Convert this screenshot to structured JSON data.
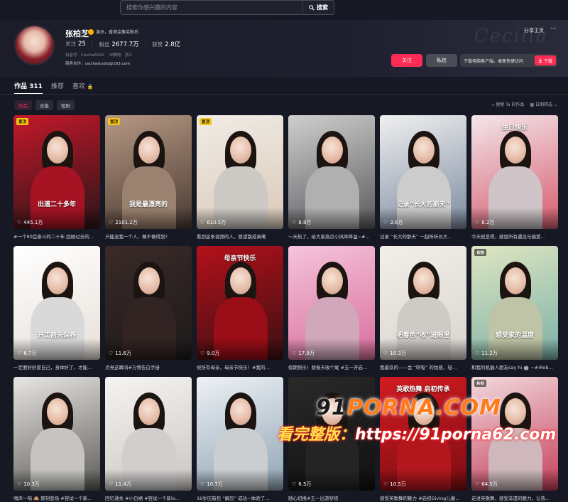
{
  "search": {
    "placeholder": "搜索你感兴趣的内容",
    "button": "搜索"
  },
  "profile": {
    "name": "张柏芝",
    "verify_text": "演员，香港金像奖影后",
    "following_label": "关注",
    "following": "25",
    "followers_label": "粉丝",
    "followers": "2677.7万",
    "likes_label": "获赞",
    "likes": "2.8亿",
    "douyin_id": "抖音号：Cecilia0524",
    "ip": "IP属地：浙江",
    "business": "商务合作：ceciliastudio@163.com",
    "signature_bg": "Cecilia",
    "share": "分享主页",
    "more": "···",
    "follow_button": "关注",
    "message_button": "私信",
    "download_text": "下载电脑客户端，桌面快捷访问",
    "download_button": "下载"
  },
  "tabs": [
    {
      "label": "作品 311"
    },
    {
      "label": "推荐"
    },
    {
      "label": "喜欢"
    }
  ],
  "chips": [
    "作品",
    "合集",
    "短剧"
  ],
  "tools": {
    "search": "搜索 Ta 的作品",
    "filter": "日期筛选"
  },
  "videos": [
    {
      "pin": "置顶",
      "likes": "445.1万",
      "caption": "出道二十多年",
      "title": "#一个90后奋斗的二十年 回顾过去的…"
    },
    {
      "pin": "置顶",
      "likes": "2101.2万",
      "caption": "我是最漂亮的",
      "title": "只能宠我一个人，做不做得到?"
    },
    {
      "pin": "置顶",
      "likes": "610.5万",
      "caption": "",
      "title": "看到这条视频的人，愿望都成真嘞"
    },
    {
      "pin": "",
      "likes": "8.8万",
      "caption": "",
      "title": "〜天热了，给大家扇点小风降降温~#…"
    },
    {
      "pin": "",
      "likes": "3.6万",
      "caption": "记录“长大的那天”",
      "title": "记录 “长大的那天” 一起听听长大…"
    },
    {
      "pin": "",
      "likes": "8.2万",
      "caption": "生日快乐",
      "title": "今天很芝得，感恩所有遇见与偏爱…"
    },
    {
      "pin": "",
      "likes": "6.7万",
      "caption": "开工前先保养",
      "title": "一定要好好爱自己，身体好了，才能…"
    },
    {
      "pin": "",
      "likes": "11.6万",
      "caption": "",
      "title": "点亮这瞬间#万物告白手册"
    },
    {
      "pin": "",
      "likes": "9.0万",
      "caption": "母亲节快乐",
      "title": "祝所有母亲，母亲节快乐！#我的…"
    },
    {
      "pin": "",
      "likes": "17.9万",
      "caption": "",
      "title": "假期快乐！替春天收个尾 #五一开启…"
    },
    {
      "pin": "",
      "likes": "10.3万",
      "caption": "把春色“收”进眼里",
      "title": "我最欢的——会 “呼吸” 的妆感，轻…"
    },
    {
      "pin": "合拍",
      "likes": "11.2万",
      "caption": "感受家的温度",
      "title": "和我的机器人朋友say hi 🤖 ~#iRob…"
    },
    {
      "pin": "",
      "likes": "10.3万",
      "caption": "",
      "title": "哨声一响 🙈 即刻登场 #容试一个新…"
    },
    {
      "pin": "",
      "likes": "11.4万",
      "caption": "",
      "title": "回忆通关 #小白裙 #容试一个新lo…"
    },
    {
      "pin": "",
      "likes": "10.7万",
      "caption": "",
      "title": "19岁压箱包 “解压” 成功~体验了…"
    },
    {
      "pin": "",
      "likes": "6.5万",
      "caption": "",
      "title": "随心切换#五一出游穿搭"
    },
    {
      "pin": "",
      "likes": "10.5万",
      "caption": "英歌热舞 启初传承",
      "title": "感受英歌舞的魅力 #启初Giving儿童…"
    },
    {
      "pin": "共创",
      "likes": "64.5万",
      "caption": "",
      "title": "走进英歌舞，感受非遗的魅力，让热…"
    }
  ],
  "watermark": {
    "line1a": "91",
    "line1b": "PORNA.COM",
    "line2a": "看完整版：",
    "line2b": "https://91porna62.com"
  }
}
